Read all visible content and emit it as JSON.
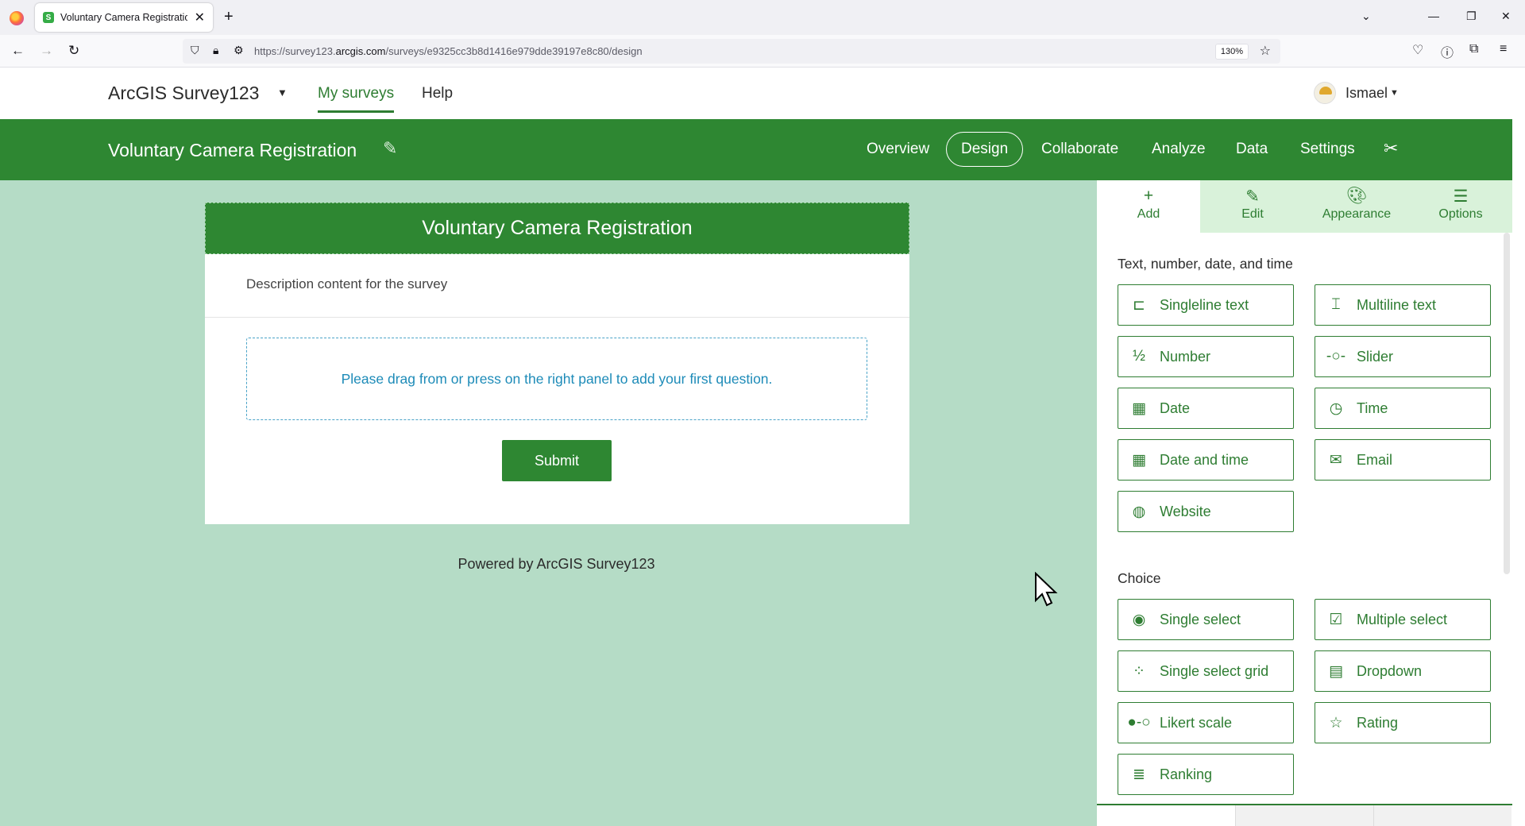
{
  "browser": {
    "tab_title": "Voluntary Camera Registration",
    "url_prefix": "https://survey123.",
    "url_domain": "arcgis.com",
    "url_path": "/surveys/e9325cc3b8d1416e979dde39197e8c80/design",
    "zoom": "130%"
  },
  "app": {
    "title": "ArcGIS Survey123",
    "nav": [
      "My surveys",
      "Help"
    ],
    "user": "Ismael"
  },
  "survey": {
    "name": "Voluntary Camera Registration",
    "tabs": [
      "Overview",
      "Design",
      "Collaborate",
      "Analyze",
      "Data",
      "Settings"
    ]
  },
  "form": {
    "header": "Voluntary Camera Registration",
    "description": "Description content for the survey",
    "dropzone": "Please drag from or press on the right panel to add your first question.",
    "submit": "Submit",
    "powered": "Powered by ArcGIS Survey123"
  },
  "panel": {
    "tabs": [
      "Add",
      "Edit",
      "Appearance",
      "Options"
    ],
    "section1": "Text, number, date, and time",
    "section2": "Choice",
    "q": {
      "singleline": "Singleline text",
      "multiline": "Multiline text",
      "number": "Number",
      "slider": "Slider",
      "date": "Date",
      "time": "Time",
      "datetime": "Date and time",
      "email": "Email",
      "website": "Website",
      "singleselect": "Single select",
      "multipleselect": "Multiple select",
      "singlegrid": "Single select grid",
      "dropdown": "Dropdown",
      "likert": "Likert scale",
      "rating": "Rating",
      "ranking": "Ranking"
    }
  },
  "colors": {
    "brand_green": "#2e8732",
    "canvas_bg": "#b5dcc6",
    "tab_bg": "#d9f2da"
  }
}
